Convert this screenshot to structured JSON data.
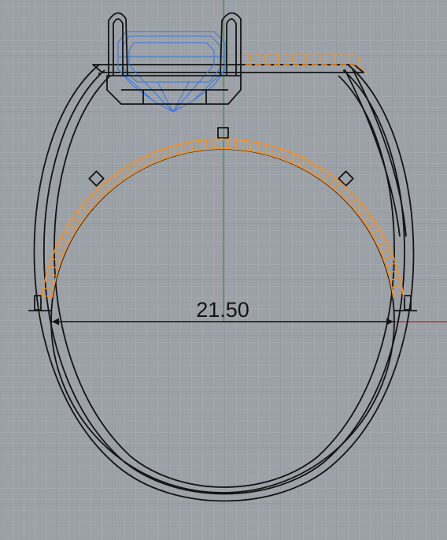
{
  "viewport": {
    "colors": {
      "background": "#9ba1a6",
      "grid_minor": "#a9afb4",
      "grid_major": "#8c9297",
      "axis_y": "#2fa02f",
      "axis_x": "#b02020",
      "outline": "#141414",
      "selection": "#f2922a",
      "gem": "#3c78e0"
    }
  },
  "dimension": {
    "value": "21.50"
  }
}
